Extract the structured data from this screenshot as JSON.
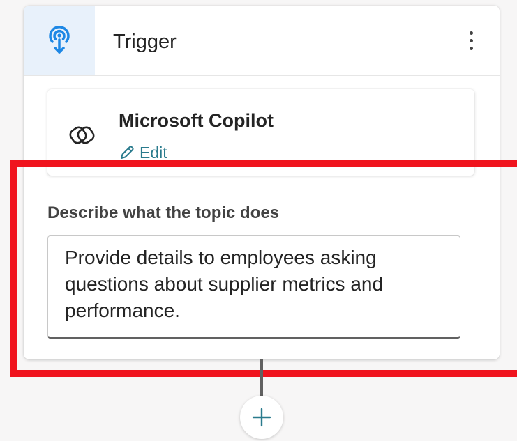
{
  "trigger_card": {
    "title": "Trigger",
    "icon": "podcast-arrow-icon",
    "menu_icon": "more-vertical-icon"
  },
  "copilot_tile": {
    "name": "Microsoft Copilot",
    "icon": "copilot-logo-icon",
    "edit_label": "Edit",
    "edit_icon": "pencil-icon"
  },
  "description": {
    "label": "Describe what the topic does",
    "value": "Provide details to employees asking questions about supplier metrics and performance."
  },
  "add_node": {
    "icon": "plus-icon"
  },
  "colors": {
    "accent": "#2a7b8d",
    "icon_blue": "#1e88e5",
    "icon_box_bg": "#e8f1fb",
    "highlight": "#f0141e"
  }
}
